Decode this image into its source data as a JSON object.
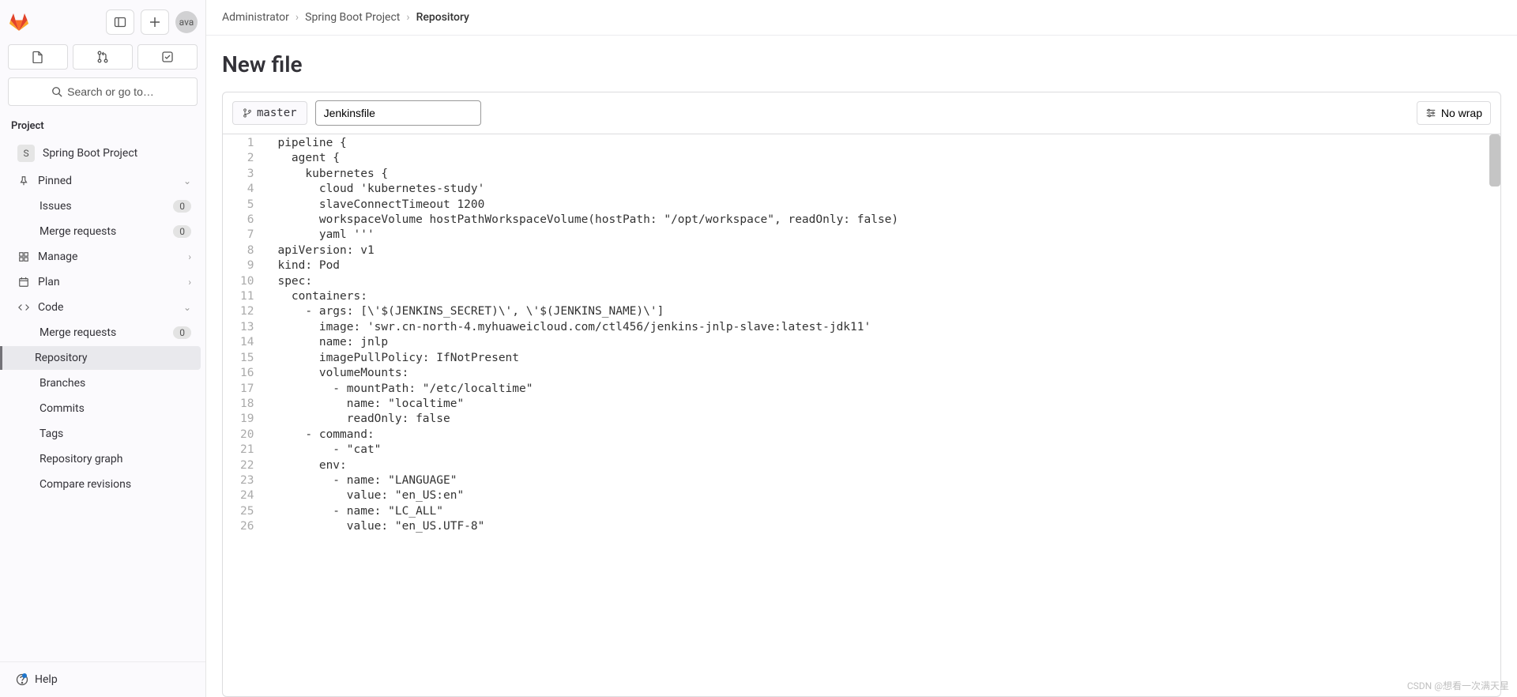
{
  "topbar": {
    "avatar_text": "ava"
  },
  "search": {
    "placeholder": "Search or go to…"
  },
  "project_section": {
    "heading": "Project"
  },
  "project": {
    "initial": "S",
    "name": "Spring Boot Project"
  },
  "sidebar": {
    "pinned": "Pinned",
    "issues": {
      "label": "Issues",
      "badge": "0"
    },
    "merge_requests_pinned": {
      "label": "Merge requests",
      "badge": "0"
    },
    "manage": "Manage",
    "plan": "Plan",
    "code": "Code",
    "merge_requests_code": {
      "label": "Merge requests",
      "badge": "0"
    },
    "repository": "Repository",
    "branches": "Branches",
    "commits": "Commits",
    "tags": "Tags",
    "repo_graph": "Repository graph",
    "compare": "Compare revisions",
    "help": "Help"
  },
  "breadcrumb": {
    "a": "Administrator",
    "b": "Spring Boot Project",
    "c": "Repository"
  },
  "page": {
    "title": "New file"
  },
  "editor": {
    "branch": "master",
    "filename": "Jenkinsfile",
    "nowrap": "No wrap"
  },
  "code_lines": [
    "pipeline {",
    "  agent {",
    "    kubernetes {",
    "      cloud 'kubernetes-study'",
    "      slaveConnectTimeout 1200",
    "      workspaceVolume hostPathWorkspaceVolume(hostPath: \"/opt/workspace\", readOnly: false)",
    "      yaml '''",
    "apiVersion: v1",
    "kind: Pod",
    "spec:",
    "  containers:",
    "    - args: [\\'$(JENKINS_SECRET)\\', \\'$(JENKINS_NAME)\\']",
    "      image: 'swr.cn-north-4.myhuaweicloud.com/ctl456/jenkins-jnlp-slave:latest-jdk11'",
    "      name: jnlp",
    "      imagePullPolicy: IfNotPresent",
    "      volumeMounts:",
    "        - mountPath: \"/etc/localtime\"",
    "          name: \"localtime\"",
    "          readOnly: false",
    "    - command:",
    "        - \"cat\"",
    "      env:",
    "        - name: \"LANGUAGE\"",
    "          value: \"en_US:en\"",
    "        - name: \"LC_ALL\"",
    "          value: \"en_US.UTF-8\""
  ],
  "watermark": "CSDN @想看一次满天星"
}
